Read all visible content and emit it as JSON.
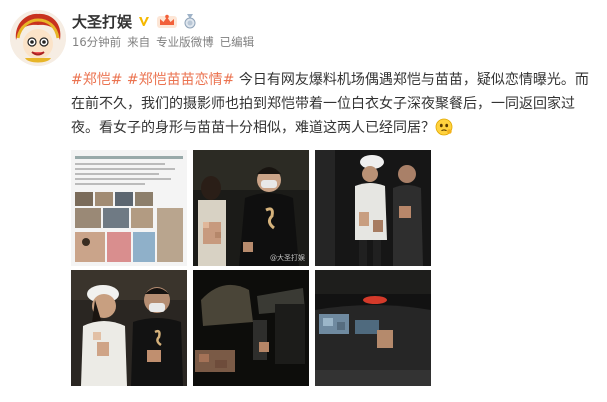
{
  "post": {
    "author": "大圣打娱",
    "time": "16分钟前",
    "from_prefix": "来自",
    "source": "专业版微博",
    "edited": "已编辑",
    "tag1": "#郑恺#",
    "tag2": "#郑恺苗苗恋情#",
    "text": " 今日有网友爆料机场偶遇郑恺与苗苗，疑似恋情曝光。而在前不久，我们的摄影师也拍到郑恺带着一位白衣女子深夜聚餐后，一同返回家过夜。看女子的身形与苗苗十分相似，难道这两人已经同居？"
  },
  "images": [
    {
      "name": "photo-collage"
    },
    {
      "name": "photo-couple-night-1",
      "watermark": "@大圣打娱"
    },
    {
      "name": "photo-couple-walking-street"
    },
    {
      "name": "photo-couple-caps-masks"
    },
    {
      "name": "photo-dark-doorway"
    },
    {
      "name": "photo-car-night"
    }
  ],
  "colors": {
    "tag": "#eb7350",
    "meta": "#808080",
    "verified_badge": "#f5b800"
  },
  "icons": {
    "verified": "verified-v-icon",
    "vip": "vip-crown-icon",
    "level": "level-medal-icon"
  }
}
